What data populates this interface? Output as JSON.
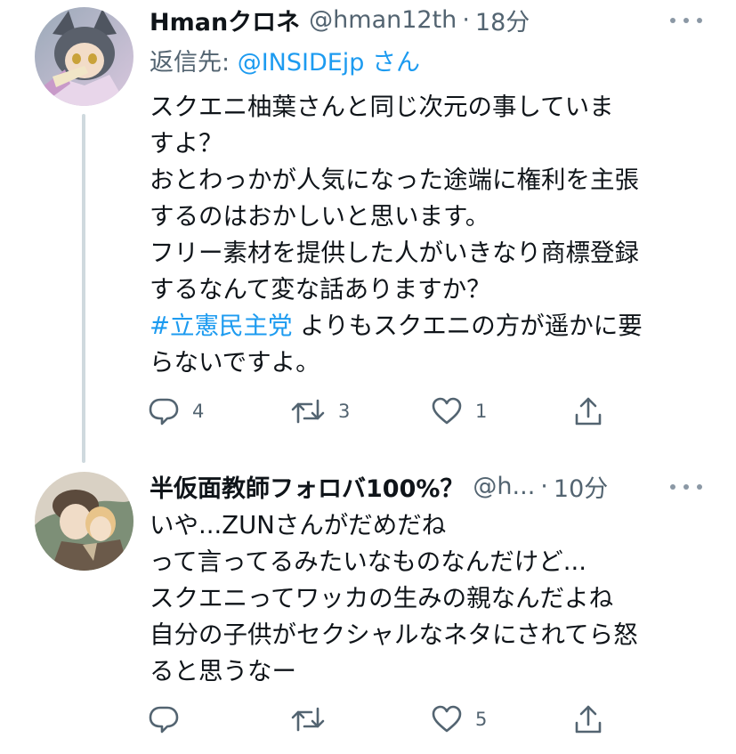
{
  "tweets": [
    {
      "name": "Hmanクロネ",
      "handle": "@hman12th",
      "separator": "·",
      "time": "18分",
      "reply_prefix": "返信先: ",
      "reply_mention": "@INSIDEjp",
      "reply_suffix": " さん",
      "lines": [
        "スクエニ柚葉さんと同じ次元の事していますよ？",
        "おとわっかが人気になった途端に権利を主張",
        "するのはおかしいと思います。",
        "フリー素材を提供した人がいきなり商標登録",
        "するなんて変な話ありますか？"
      ],
      "line_wrap": [
        "スクエニ柚葉さんと同じ次元の事していま",
        "すよ？"
      ],
      "hashtag": "#立憲民主党",
      "hashtag_rest": " よりもスクエニの方が遥かに要",
      "last_line": "らないですよ。",
      "reply_count": "4",
      "retweet_count": "3",
      "like_count": "1"
    },
    {
      "name": "半仮面教師フォロバ100%？",
      "handle": "@h...",
      "separator": "·",
      "time": "10分",
      "lines": [
        "いや...ZUNさんがだめだね",
        "って言ってるみたいなものなんだけど...",
        "スクエニってワッカの生みの親なんだよね",
        "自分の子供がセクシャルなネタにされてら怒",
        "ると思うなー"
      ],
      "reply_count": "",
      "retweet_count": "",
      "like_count": "5"
    }
  ],
  "icons": {
    "more": "more-dots-icon",
    "reply": "reply-bubble-icon",
    "retweet": "retweet-arrows-icon",
    "like": "heart-icon",
    "share": "share-upload-icon"
  },
  "colors": {
    "link": "#1d9bf0",
    "secondary_text": "#536471",
    "primary_text": "#0f1419",
    "thread_line": "#cfd9de"
  }
}
